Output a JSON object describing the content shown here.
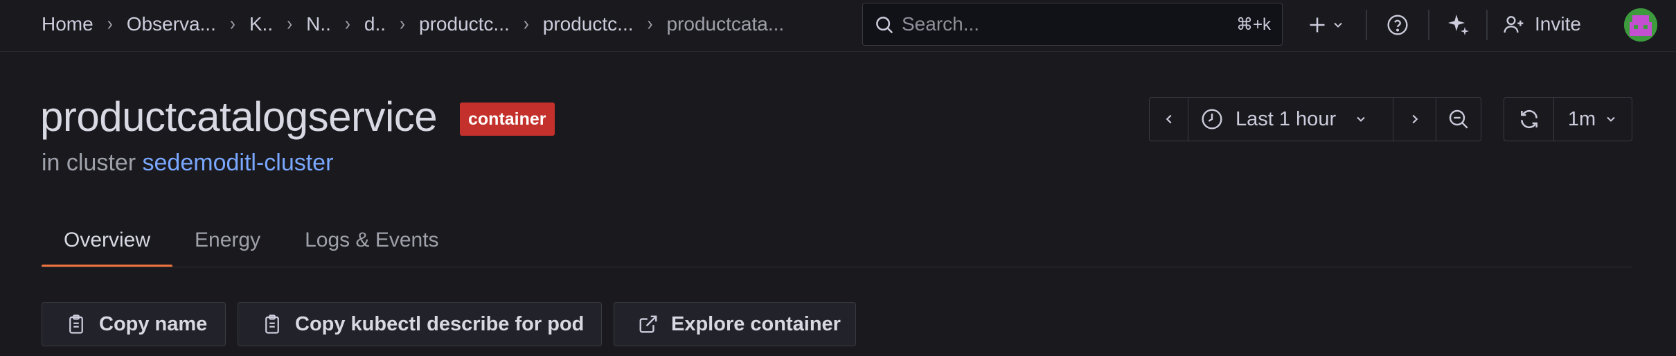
{
  "breadcrumbs": [
    {
      "label": "Home"
    },
    {
      "label": "Observa..."
    },
    {
      "label": "K.."
    },
    {
      "label": "N.."
    },
    {
      "label": "d.."
    },
    {
      "label": "productc..."
    },
    {
      "label": "productc..."
    },
    {
      "label": "productcata..."
    }
  ],
  "search": {
    "placeholder": "Search...",
    "shortcut": "⌘+k"
  },
  "topbar": {
    "invite_label": "Invite",
    "icons": [
      "plus-icon",
      "chevron-down-icon",
      "help-icon",
      "sparkle-icon",
      "add-user-icon",
      "avatar"
    ]
  },
  "header": {
    "title": "productcatalogservice",
    "badge": "container",
    "subtitle_prefix": "in cluster",
    "cluster_link": "sedemoditl-cluster",
    "badge_color": "#c4302b",
    "link_color": "#7aa7ff"
  },
  "time": {
    "range_label": "Last 1 hour",
    "refresh_interval": "1m"
  },
  "tabs": [
    {
      "label": "Overview",
      "active": true
    },
    {
      "label": "Energy",
      "active": false
    },
    {
      "label": "Logs & Events",
      "active": false
    }
  ],
  "actions": {
    "copy_name": "Copy name",
    "copy_kubectl": "Copy kubectl describe for pod",
    "explore": "Explore container"
  },
  "colors": {
    "background": "#19191e",
    "accent_tab": "#f0733e"
  }
}
